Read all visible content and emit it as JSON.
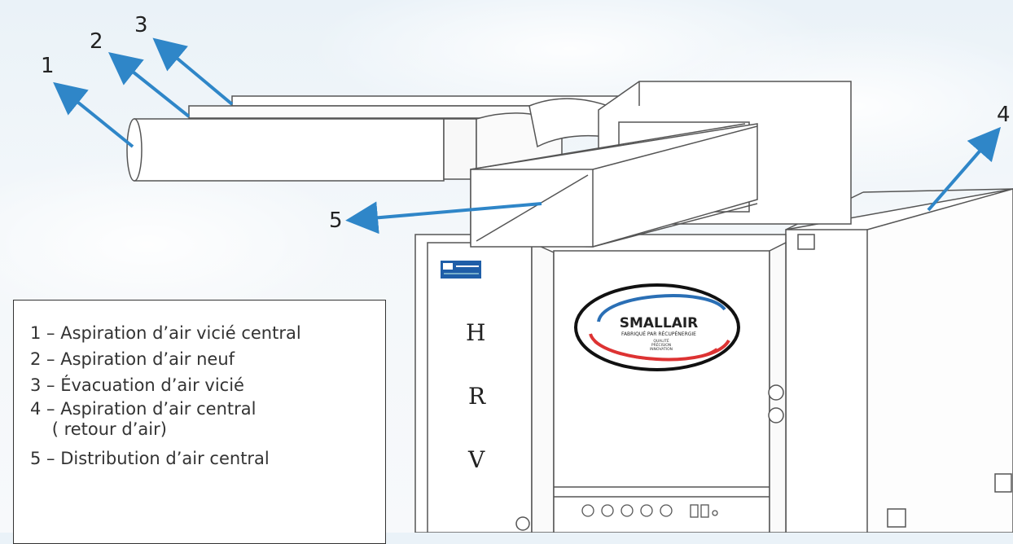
{
  "callouts": [
    "1",
    "2",
    "3",
    "4",
    "5"
  ],
  "legend": {
    "items": [
      "1 – Aspiration d’air vicié central",
      "2 – Aspiration d’air neuf",
      "3 – Évacuation d’air vicié",
      "4 – Aspiration d’air central",
      "    ( retour d’air)",
      "5 – Distribution d’air central"
    ]
  },
  "unit": {
    "letters": [
      "H",
      "R",
      "V"
    ],
    "logo_main": "SMALLAIR",
    "logo_sub": "FABRIQUÉ PAR RÉCUPÉNERGIE",
    "logo_tagline": [
      "QUALITÉ",
      "PRÉCISION",
      "INNOVATION"
    ]
  },
  "colors": {
    "arrow": "#2f86c8",
    "line": "#555555",
    "logo_red": "#d33",
    "logo_blue": "#2a6fb5"
  },
  "icons": [
    "arrow-icon",
    "logo-emblem",
    "control-knob-icon",
    "display-digit-icon"
  ]
}
